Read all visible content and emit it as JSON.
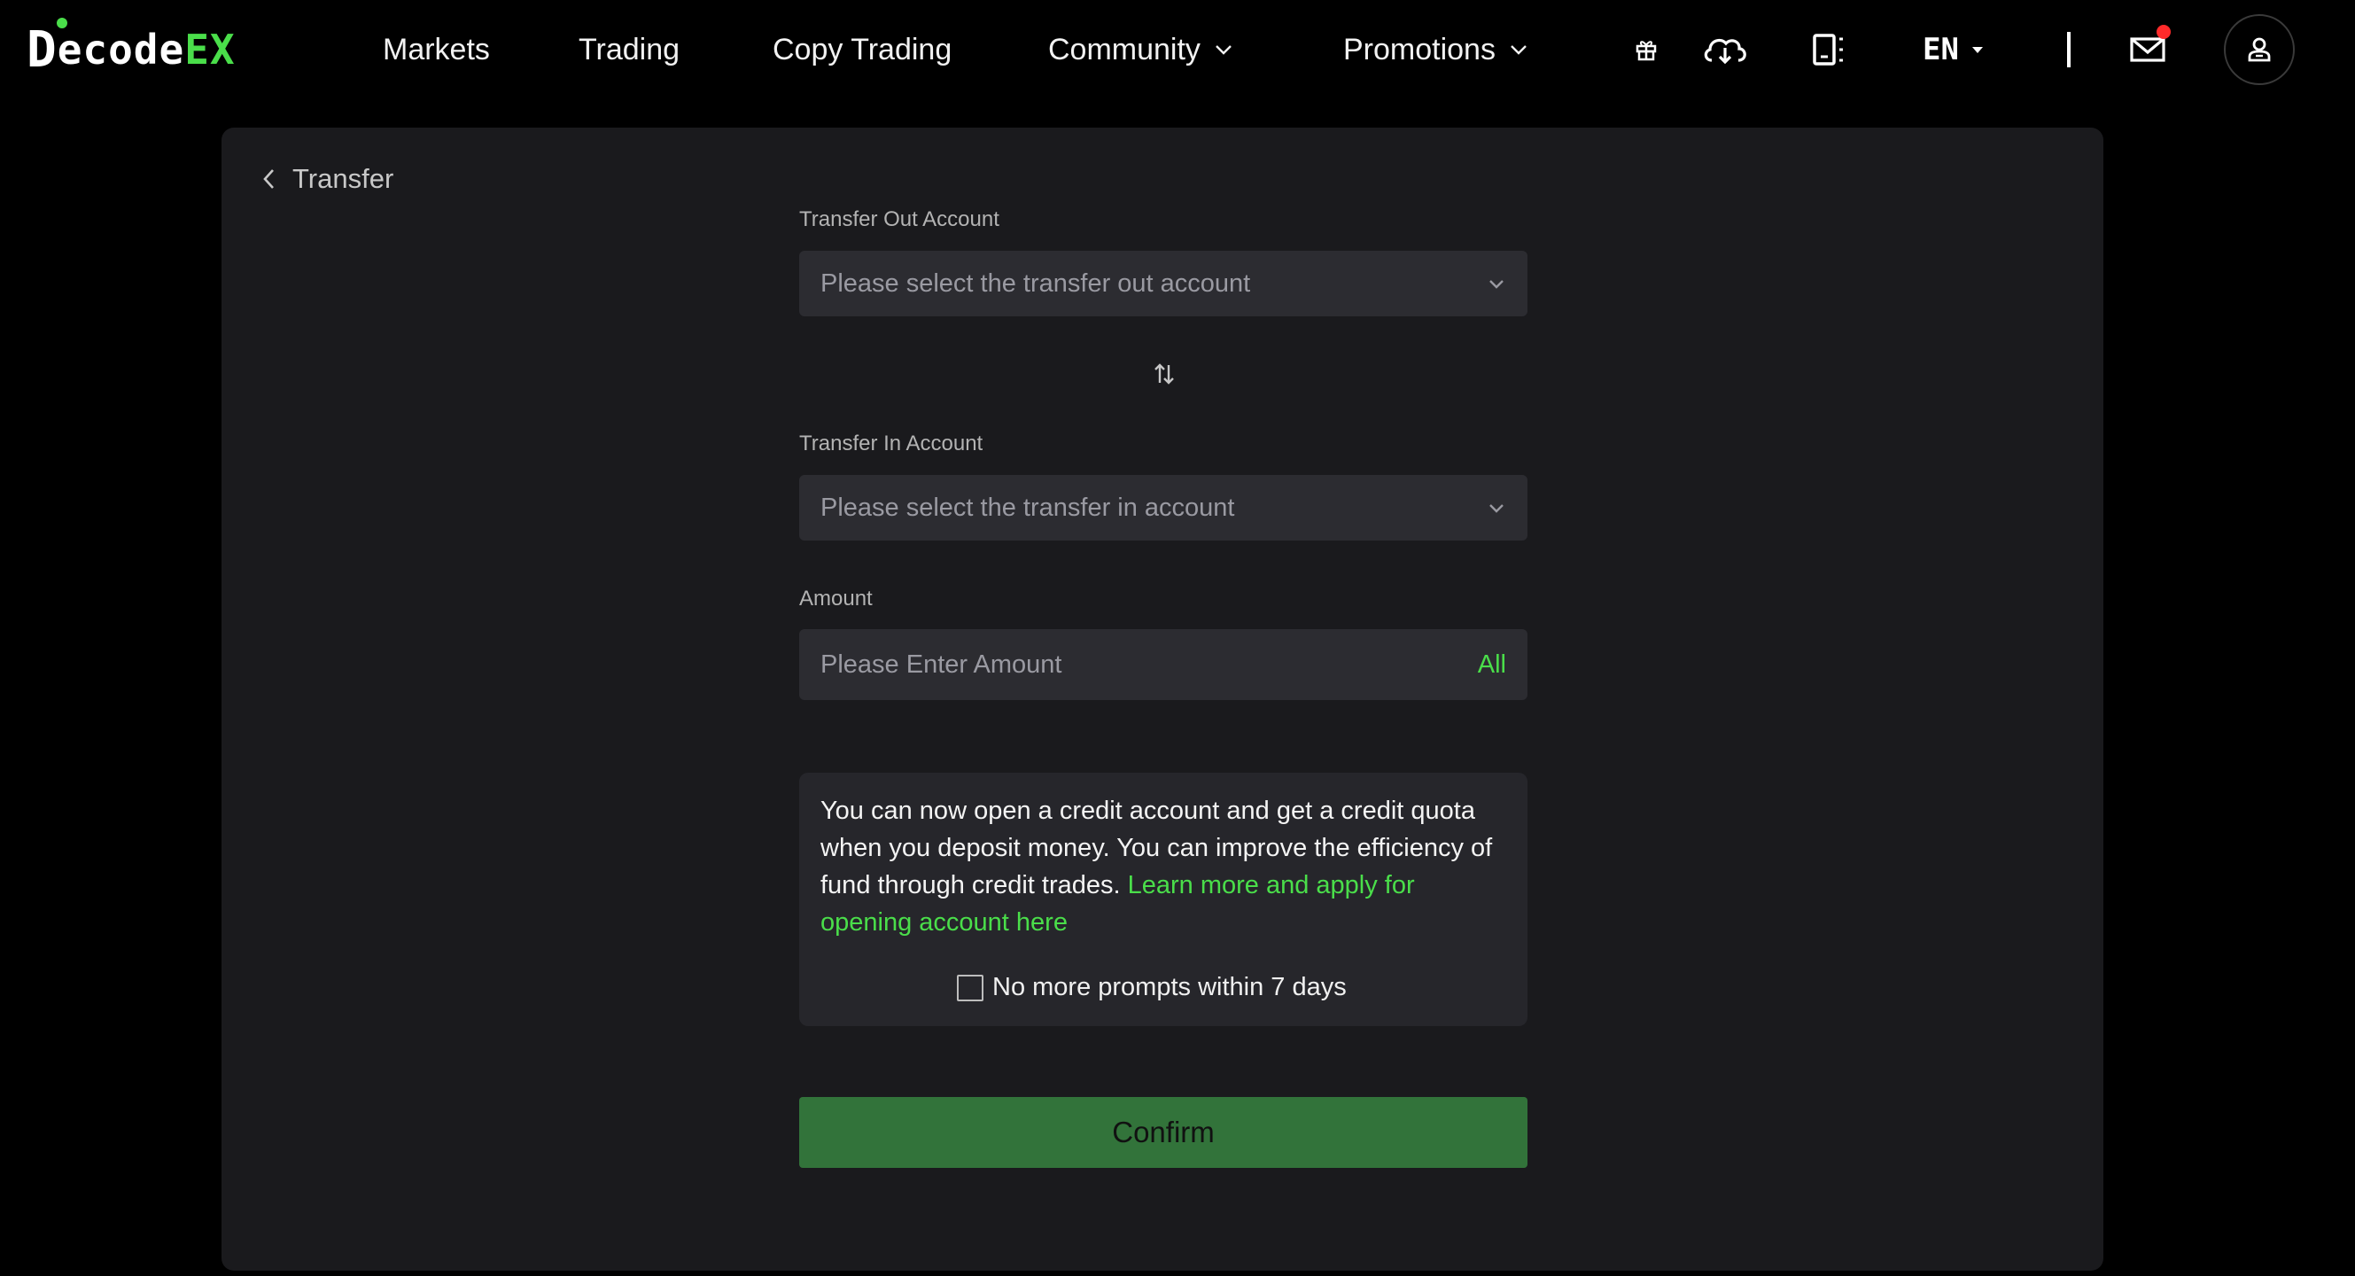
{
  "header": {
    "logo": {
      "first": "D",
      "middle": "ecode",
      "accent": "EX"
    },
    "nav": [
      {
        "label": "Markets"
      },
      {
        "label": "Trading"
      },
      {
        "label": "Copy Trading"
      },
      {
        "label": "Community",
        "has_dropdown": true
      },
      {
        "label": "Promotions",
        "has_dropdown": true
      }
    ],
    "icons": [
      "gift-icon",
      "cloud-download-icon",
      "phone-scan-icon"
    ],
    "language": "EN",
    "mail_has_notification": true
  },
  "page": {
    "back_label": "Transfer",
    "transfer_out": {
      "label": "Transfer Out Account",
      "placeholder": "Please select the transfer out account"
    },
    "transfer_in": {
      "label": "Transfer In Account",
      "placeholder": "Please select the transfer in account"
    },
    "amount": {
      "label": "Amount",
      "placeholder": "Please Enter Amount",
      "all_label": "All"
    },
    "notice": {
      "text": "You can now open a credit account and get a credit quota when you deposit money. You can improve the efficiency of fund through credit trades. ",
      "link": "Learn more and apply for opening account here",
      "checkbox_label": "No more prompts within 7 days"
    },
    "confirm_label": "Confirm"
  },
  "colors": {
    "background": "#000000",
    "panel": "#1a1a1d",
    "field": "#2c2c31",
    "accent": "#4ade4a",
    "confirm": "#32733a",
    "notification": "#ff2a2a"
  }
}
